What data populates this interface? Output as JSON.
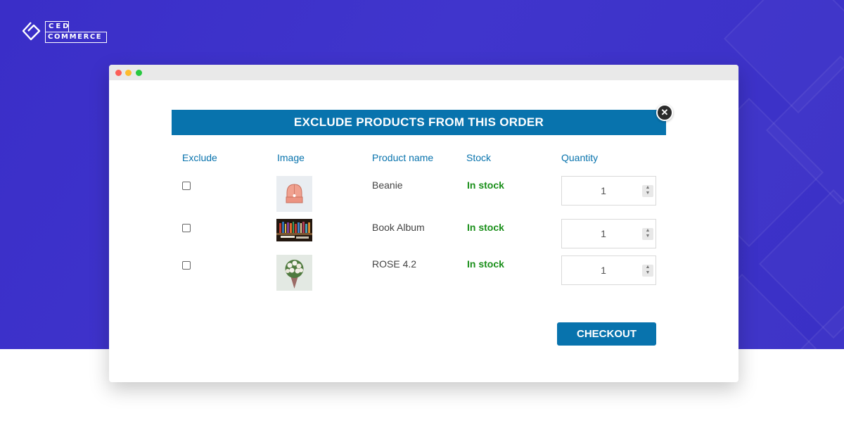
{
  "brand": {
    "logo_top": "CED",
    "logo_bottom": "COMMERCE"
  },
  "modal": {
    "title": "EXCLUDE PRODUCTS FROM THIS ORDER",
    "close_icon": "close-icon",
    "columns": [
      "Exclude",
      "Image",
      "Product name",
      "Stock",
      "Quantity"
    ],
    "rows": [
      {
        "name": "Beanie",
        "stock": "In stock",
        "quantity": "1",
        "image_icon": "beanie-image"
      },
      {
        "name": "Book Album",
        "stock": "In stock",
        "quantity": "1",
        "image_icon": "books-image"
      },
      {
        "name": "ROSE 4.2",
        "stock": "In stock",
        "quantity": "1",
        "image_icon": "rose-bouquet-image"
      }
    ],
    "checkout_label": "CHECKOUT"
  },
  "colors": {
    "hero_background": "#3a2ec8",
    "accent": "#0873ad",
    "stock_green": "#1a8f1a"
  }
}
